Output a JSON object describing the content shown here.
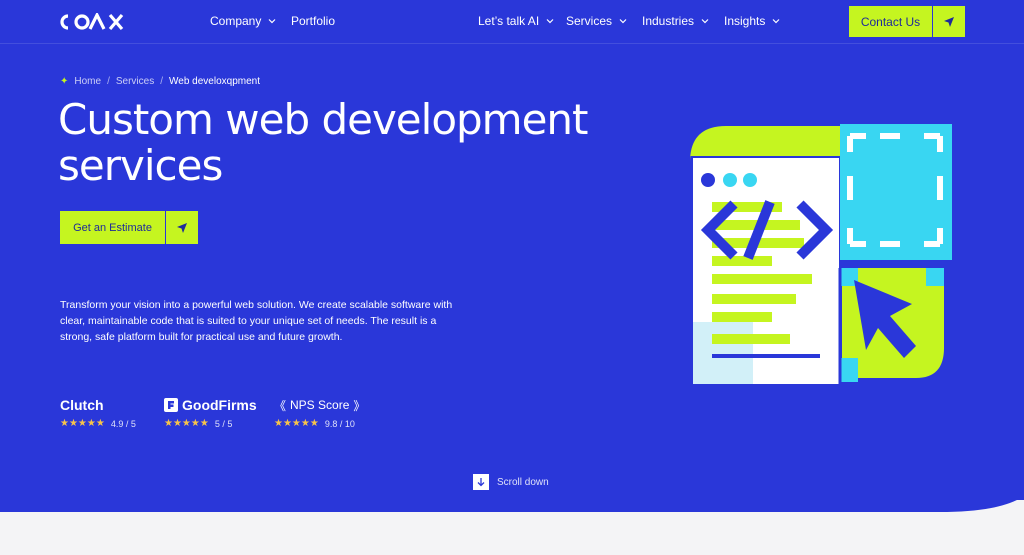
{
  "header": {
    "logo": "COAX",
    "nav_left": [
      {
        "label": "Company",
        "dropdown": true
      },
      {
        "label": "Portfolio",
        "dropdown": false
      }
    ],
    "nav_right": [
      {
        "label": "Let’s talk AI",
        "dropdown": true
      },
      {
        "label": "Services",
        "dropdown": true
      },
      {
        "label": "Industries",
        "dropdown": true
      },
      {
        "label": "Insights",
        "dropdown": true
      }
    ],
    "contact_label": "Contact Us"
  },
  "breadcrumb": {
    "items": [
      "Home",
      "Services"
    ],
    "current": "Web develoxqpment",
    "separator": "/"
  },
  "hero": {
    "title_line1": "Custom web development",
    "title_line2": "services",
    "cta_label": "Get an Estimate",
    "description": "Transform your vision into a powerful web solution. We create scalable software with clear, maintainable code that is suited to your unique set of needs. The result is a strong, safe platform built for practical use and future growth."
  },
  "ratings": [
    {
      "brand": "Clutch",
      "stars": "★★★★★",
      "score": "4.9 / 5"
    },
    {
      "brand": "GoodFirms",
      "stars": "★★★★★",
      "score": "5 / 5"
    },
    {
      "brand": "NPS Score",
      "stars": "★★★★★",
      "score": "9.8 / 10"
    }
  ],
  "scroll_label": "Scroll down",
  "colors": {
    "hero_bg": "#2a37d9",
    "accent": "#c5f520",
    "cyan": "#39d6f2",
    "star": "#f6c34a"
  }
}
